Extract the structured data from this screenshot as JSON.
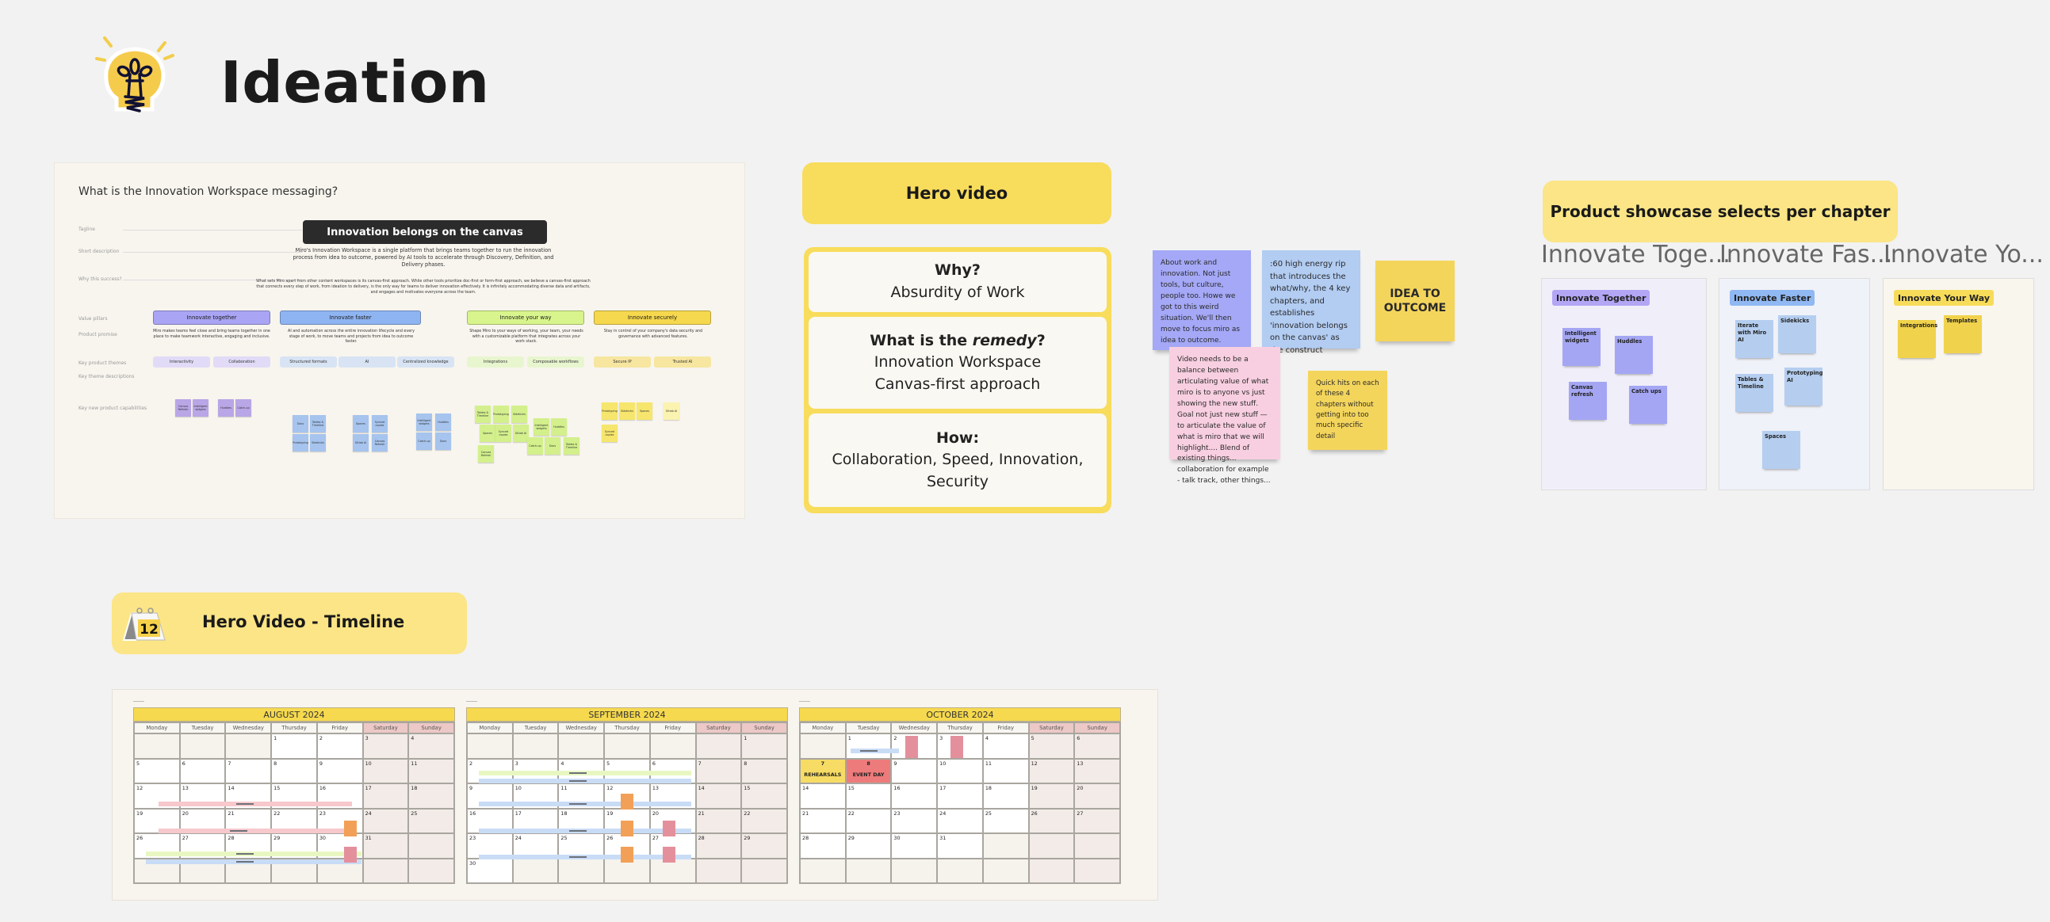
{
  "board": {
    "title": "Ideation",
    "title_icon": "lightbulb-icon"
  },
  "messaging": {
    "question": "What is the Innovation Workspace messaging?",
    "row_labels": [
      "Tagline",
      "Short description",
      "Why this success?",
      "Value pillars",
      "Product promise",
      "Key product themes",
      "Key theme descriptions",
      "Key new product capabilities"
    ],
    "tagline": "Innovation belongs on the canvas",
    "short_description": "Miro's Innovation Workspace is a single platform that brings teams together to run the innovation process from idea to outcome, powered by AI tools to accelerate through Discovery, Definition, and Delivery phases.",
    "why": "What sets Miro apart from other content workspaces is its canvas-first approach. While other tools prioritize doc-first or form-first approach, we believe a canvas-first approach that connects every step of work, from ideation to delivery, is the only way for teams to deliver innovation effectively. It is infinitely accommodating diverse data and artifacts, and engages and motivates everyone across the team.",
    "pillars": [
      {
        "label": "Innovate together",
        "color": "#a9a4f4",
        "promise": "Miro makes teams feel close and bring teams together in one place to make teamwork interactive, engaging and inclusive."
      },
      {
        "label": "Innovate faster",
        "color": "#8fb4f2",
        "promise": "AI and automation across the entire innovation lifecycle and every stage of work, to move teams and projects from idea to outcome faster."
      },
      {
        "label": "Innovate your way",
        "color": "#d8f48c",
        "promise": "Shape Miro to your ways of working, your team, your needs with a customizable platform that integrates across your work stack."
      },
      {
        "label": "Innovate securely",
        "color": "#f6d84e",
        "promise": "Stay in control of your company's data security and governance with advanced features."
      }
    ],
    "themes": [
      {
        "label": "Interactivity",
        "color": "#e1dbf7"
      },
      {
        "label": "Collaboration",
        "color": "#e1dbf7"
      },
      {
        "label": "Structured formats",
        "color": "#d8e4f4"
      },
      {
        "label": "AI",
        "color": "#d8e4f4"
      },
      {
        "label": "Centralized knowledge",
        "color": "#d8e4f4"
      },
      {
        "label": "Integrations",
        "color": "#e8f6cf"
      },
      {
        "label": "Composable workflows",
        "color": "#e8f6cf"
      },
      {
        "label": "Secure IP",
        "color": "#f7e6a0"
      },
      {
        "label": "Trusted AI",
        "color": "#f7e6a0"
      }
    ],
    "capabilities": [
      "Canvas Refresh",
      "Intelligent widgets",
      "Huddles",
      "Catch-up",
      "Docs",
      "Tables & Timeline",
      "Prototyping",
      "Sidekicks",
      "Spaces",
      "Synced copies",
      "Gitlab AI"
    ]
  },
  "hero_video": {
    "header": "Hero video",
    "sections": [
      {
        "heading": "Why?",
        "body": "Absurdity of Work"
      },
      {
        "heading_pre": "What is the ",
        "heading_em": "remedy",
        "heading_post": "?",
        "body_lines": [
          "Innovation Workspace",
          "Canvas-first approach"
        ]
      },
      {
        "heading": "How:",
        "body_lines": [
          "Collaboration, Speed, Innovation,",
          "Security"
        ]
      }
    ]
  },
  "stickies": [
    {
      "text": "About work and innovation. Not just tools, but culture, people too. Howe we got to this weird situation. We'll then move to focus miro as idea to outcome.",
      "color": "#a4a8f6"
    },
    {
      "text": ":60 high energy rip that introduces the what/why, the 4 key chapters, and establishes 'innovation belongs on the canvas' as the construct",
      "color": "#b2ccf2"
    },
    {
      "text": "IDEA TO OUTCOME",
      "color": "#f4d55c"
    },
    {
      "text": "Video needs to be a balance between articulating value of what miro is to anyone vs just showing the new stuff. Goal not just new stuff — to articulate the value of what is miro that we will highlight.... Blend of existing things... collaboration for example - talk track, other things...",
      "color": "#f8cfe0"
    },
    {
      "text": "Quick hits on each of these 4 chapters without getting into too much specific detail",
      "color": "#f4d55c"
    }
  ],
  "product_showcase": {
    "header": "Product showcase selects per chapter",
    "columns": [
      {
        "title": "Innovate Toge...",
        "tag": "Innovate Together",
        "tag_color": "#b3a6f5",
        "bg": "#f0eff9",
        "note_color": "#a4a6f4",
        "notes": [
          "Intelligent widgets",
          "Huddles",
          "Canvas refresh",
          "Catch ups"
        ]
      },
      {
        "title": "Innovate Fas...",
        "tag": "Innovate Faster",
        "tag_color": "#90b8f2",
        "bg": "#f0f2f9",
        "note_color": "#b5cef0",
        "notes": [
          "Iterate with Miro AI",
          "Sidekicks",
          "Tables & Timeline",
          "Prototyping AI",
          "Spaces"
        ]
      },
      {
        "title": "Innovate Yo...",
        "tag": "Innovate Your Way",
        "tag_color": "#f7dc5a",
        "bg": "#f9f6ee",
        "note_color": "#f1d24c",
        "notes": [
          "Integrations",
          "Templates"
        ]
      }
    ]
  },
  "timeline": {
    "header": "Hero Video - Timeline",
    "header_icon": "calendar-icon",
    "icon_day": "12",
    "weekdays": [
      "Monday",
      "Tuesday",
      "Wednesday",
      "Thursday",
      "Friday",
      "Saturday",
      "Sunday"
    ],
    "months": [
      {
        "name": "AUGUST 2024",
        "offset": 3,
        "days": 31
      },
      {
        "name": "SEPTEMBER 2024",
        "offset": 6,
        "days": 30
      },
      {
        "name": "OCTOBER 2024",
        "offset": 1,
        "days": 31,
        "special": [
          {
            "day": 7,
            "label": "REHEARSALS",
            "kind": "reh"
          },
          {
            "day": 8,
            "label": "EVENT DAY",
            "kind": "evt"
          }
        ]
      }
    ]
  }
}
